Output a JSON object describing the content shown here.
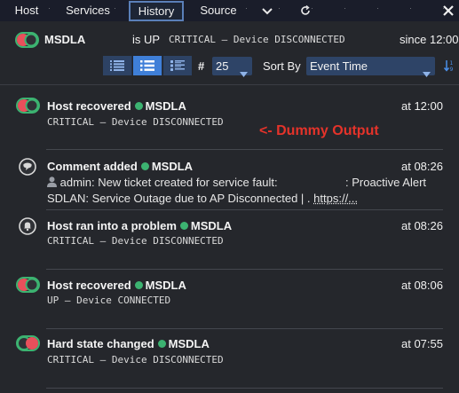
{
  "tabs": [
    {
      "label": "Host"
    },
    {
      "label": "Services"
    },
    {
      "label": "History",
      "active": true
    },
    {
      "label": "Source"
    }
  ],
  "tab_icons": [
    "chevron-down-icon",
    "refresh-icon",
    "close-icon"
  ],
  "header": {
    "host": "MSDLA",
    "state": "is UP",
    "output": "CRITICAL – Device DISCONNECTED",
    "since": "since 12:00"
  },
  "controls": {
    "view_modes": [
      "compact-list",
      "list",
      "detailed-list"
    ],
    "active_view": "list",
    "limit_label": "#",
    "limit_value": "25",
    "sort_label": "Sort By",
    "sort_value": "Event Time"
  },
  "annotation": "<- Dummy Output",
  "history": [
    {
      "icon": "toggle-recovered-icon",
      "title": "Host recovered",
      "host": "MSDLA",
      "time": "at 12:00",
      "output": "CRITICAL – Device DISCONNECTED"
    },
    {
      "icon": "comment-icon",
      "title": "Comment added",
      "host": "MSDLA",
      "time": "at 08:26",
      "line1_author": "admin:",
      "line1_text": "New ticket created for service fault:",
      "line1_tail": ": Proactive Alert",
      "line2": "SDLAN: Service Outage due to AP Disconnected | .",
      "line2_link": "https://..."
    },
    {
      "icon": "bell-icon",
      "title": "Host ran into a problem",
      "host": "MSDLA",
      "time": "at 08:26",
      "output": "CRITICAL – Device DISCONNECTED"
    },
    {
      "icon": "toggle-recovered-icon",
      "title": "Host recovered",
      "host": "MSDLA",
      "time": "at 08:06",
      "output": "UP – Device CONNECTED"
    },
    {
      "icon": "toggle-hard-state-icon",
      "title": "Hard state changed",
      "host": "MSDLA",
      "time": "at 07:55",
      "output": "CRITICAL – Device DISCONNECTED"
    }
  ],
  "colors": {
    "critical": "#e8505b",
    "ok": "#3cb371",
    "accent": "#3f7fd8",
    "annotation": "#e5332a"
  }
}
